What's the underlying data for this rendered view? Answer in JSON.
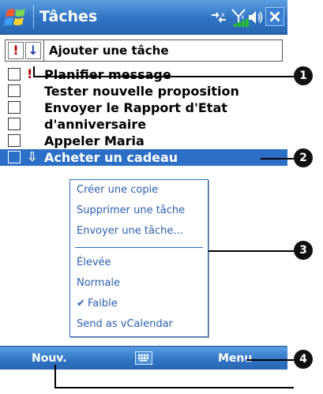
{
  "titlebar": {
    "title": "Tâches",
    "icons": [
      "windows-flag-icon",
      "connectivity-icon",
      "signal-icon",
      "volume-icon",
      "close-icon"
    ]
  },
  "toolbar": {
    "priority_high_label": "!",
    "priority_low_label": "↓",
    "add_task_placeholder": "Ajouter une tâche"
  },
  "tasks": [
    {
      "label": "Planifier message",
      "priority": "!"
    },
    {
      "label": "Tester nouvelle proposition",
      "priority": ""
    },
    {
      "label": "Envoyer le Rapport d'Etat",
      "priority": ""
    },
    {
      "label": "d'anniversaire",
      "priority": ""
    },
    {
      "label": "Appeler Maria",
      "priority": ""
    },
    {
      "label": "Acheter un cadeau",
      "priority": "⇩"
    }
  ],
  "context_menu": {
    "items": [
      "Créer une copie",
      "Supprimer une tâche",
      "Envoyer une tâche...",
      "Élevée",
      "Normale",
      "Faible",
      "Send as vCalendar"
    ],
    "checked_mark": "✔"
  },
  "softkeys": {
    "left": "Nouv.",
    "right": "Menu"
  },
  "callouts": [
    "1",
    "2",
    "3",
    "4"
  ],
  "colors": {
    "titlebar": "#2f73c4",
    "selection": "#2b6fc6",
    "menu_text": "#2a5fb0",
    "priority_high": "#b00000"
  }
}
